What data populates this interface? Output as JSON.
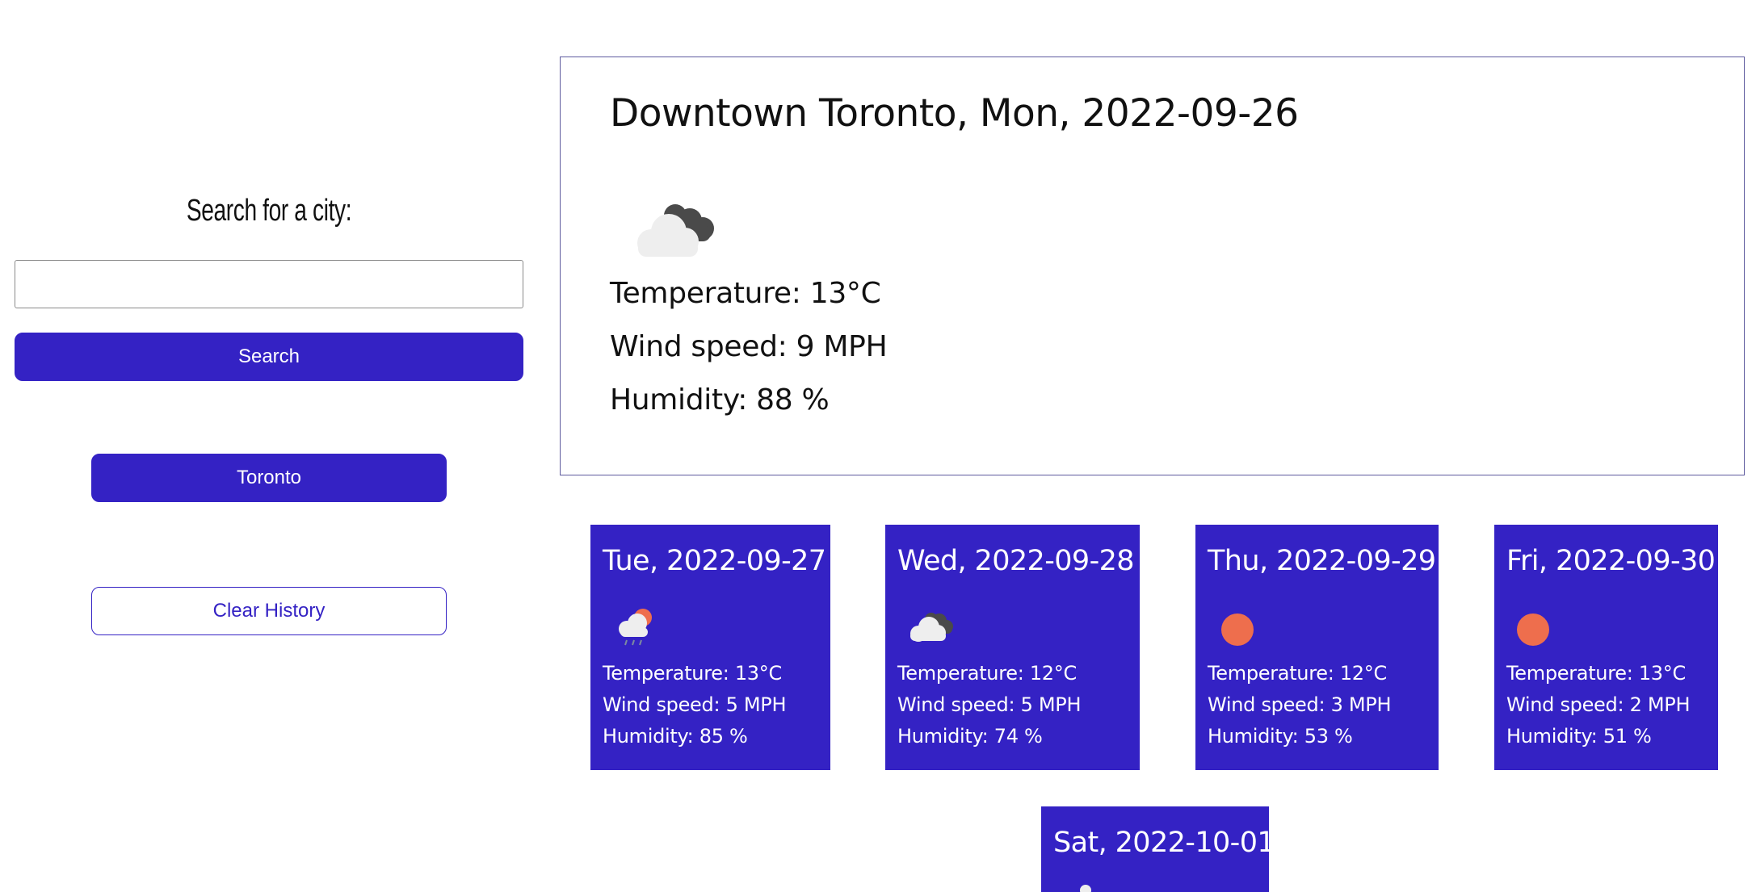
{
  "sidebar": {
    "heading": "Search for a city:",
    "search_placeholder": "",
    "search_value": "",
    "search_label": "Search",
    "history": [
      "Toronto"
    ],
    "clear_label": "Clear History"
  },
  "current": {
    "title": "Downtown Toronto, Mon, 2022-09-26",
    "icon": "broken-clouds-icon",
    "temperature": "Temperature: 13°C",
    "wind": "Wind speed: 9 MPH",
    "humidity": "Humidity: 88 %"
  },
  "forecast": [
    {
      "date": "Tue, 2022-09-27",
      "icon": "rain-sun-icon",
      "temperature": "Temperature: 13°C",
      "wind": "Wind speed: 5 MPH",
      "humidity": "Humidity: 85 %"
    },
    {
      "date": "Wed, 2022-09-28",
      "icon": "broken-clouds-icon",
      "temperature": "Temperature: 12°C",
      "wind": "Wind speed: 5 MPH",
      "humidity": "Humidity: 74 %"
    },
    {
      "date": "Thu, 2022-09-29",
      "icon": "sun-icon",
      "temperature": "Temperature: 12°C",
      "wind": "Wind speed: 3 MPH",
      "humidity": "Humidity: 53 %"
    },
    {
      "date": "Fri, 2022-09-30",
      "icon": "sun-icon",
      "temperature": "Temperature: 13°C",
      "wind": "Wind speed: 2 MPH",
      "humidity": "Humidity: 51 %"
    },
    {
      "date": "Sat, 2022-10-01"
    }
  ],
  "colors": {
    "accent": "#3422c4",
    "sun": "#ee6e4d",
    "cloud_light": "#eeeeee",
    "cloud_dark": "#4a4a4a"
  }
}
